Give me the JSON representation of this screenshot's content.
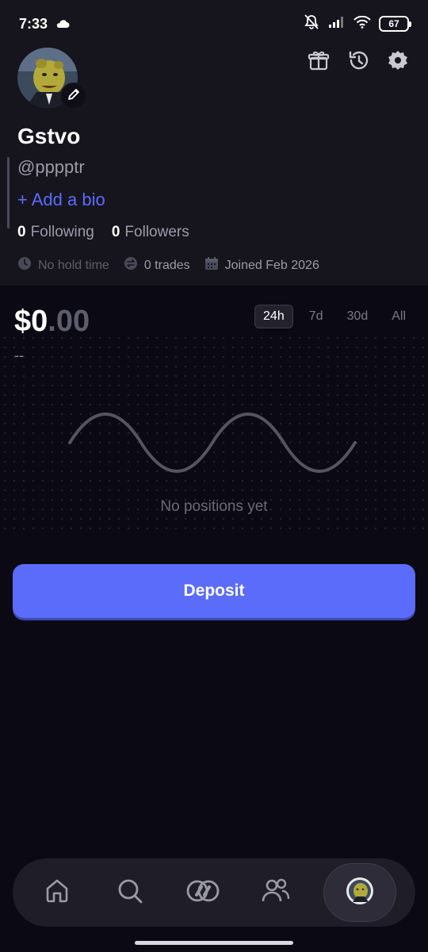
{
  "status_bar": {
    "time": "7:33",
    "battery": "67",
    "icons": [
      "cloud-icon",
      "mute-icon",
      "signal-icon",
      "wifi-icon",
      "battery-icon"
    ]
  },
  "profile": {
    "display_name": "Gstvo",
    "handle": "@pppptr",
    "add_bio": "+ Add a bio",
    "following_count": "0",
    "following_label": "Following",
    "followers_count": "0",
    "followers_label": "Followers",
    "hold_time": "No hold time",
    "trades": "0 trades",
    "joined": "Joined Feb 2026"
  },
  "header_icons": [
    "gift-icon",
    "history-icon",
    "settings-icon"
  ],
  "portfolio": {
    "balance_main": "$0",
    "balance_cents": ".00",
    "change": "--",
    "ranges": [
      "24h",
      "7d",
      "30d",
      "All"
    ],
    "active_range": "24h",
    "empty_text": "No positions yet"
  },
  "deposit": {
    "label": "Deposit"
  },
  "nav": {
    "items": [
      "home-icon",
      "search-icon",
      "trade-icon",
      "friends-icon",
      "profile-avatar"
    ],
    "active": "profile-avatar"
  },
  "colors": {
    "accent": "#5a6cf9",
    "link": "#5b6cff",
    "background": "#0b0a14",
    "header_bg": "#16151d"
  }
}
